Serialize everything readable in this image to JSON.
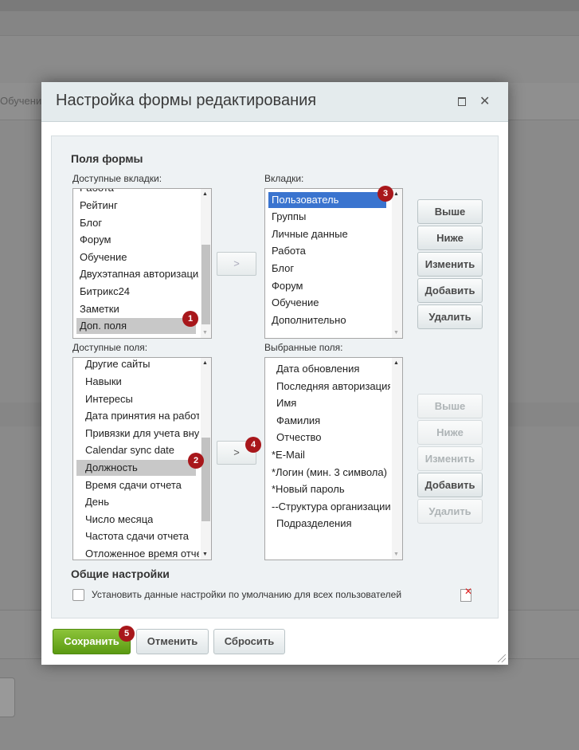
{
  "background": {
    "tab_fragment": "Обучение"
  },
  "dialog": {
    "title": "Настройка формы редактирования",
    "section_fields": "Поля формы",
    "available_tabs_label": "Доступные вкладки:",
    "tabs_label": "Вкладки:",
    "available_fields_label": "Доступные поля:",
    "selected_fields_label": "Выбранные поля:",
    "available_tabs": [
      "Работа",
      "Рейтинг",
      "Блог",
      "Форум",
      "Обучение",
      "Двухэтапная авторизация",
      "Битрикс24",
      "Заметки",
      "Доп. поля"
    ],
    "tabs": [
      "Пользователь",
      "Группы",
      "Личные данные",
      "Работа",
      "Блог",
      "Форум",
      "Обучение",
      "Дополнительно"
    ],
    "available_fields": [
      "Другие сайты",
      "Навыки",
      "Интересы",
      "Дата принятия на работу",
      "Привязки для учета внутренних",
      "Calendar sync date",
      "Должность",
      "Время сдачи отчета",
      "День",
      "Число месяца",
      "Частота сдачи отчета",
      "Отложенное время отчета"
    ],
    "selected_fields": [
      "Дата обновления",
      "Последняя авторизация",
      "Имя",
      "Фамилия",
      "Отчество",
      "*E-Mail",
      "*Логин (мин. 3 символа)",
      "*Новый пароль",
      "--Структура организации",
      "Подразделения"
    ],
    "move_tab_button": ">",
    "move_field_button": ">",
    "tab_buttons": {
      "up": "Выше",
      "down": "Ниже",
      "edit": "Изменить",
      "add": "Добавить",
      "delete": "Удалить"
    },
    "field_buttons": {
      "up": "Выше",
      "down": "Ниже",
      "edit": "Изменить",
      "add": "Добавить",
      "delete": "Удалить"
    },
    "section_general": "Общие настройки",
    "default_checkbox_label": "Установить данные настройки по умолчанию для всех пользователей",
    "footer": {
      "save": "Сохранить",
      "cancel": "Отменить",
      "reset": "Сбросить"
    },
    "badges": [
      "1",
      "2",
      "3",
      "4",
      "5"
    ]
  },
  "colors": {
    "selected": "#3a74cf",
    "highlight": "#c8c8c8",
    "badge": "#a8171b",
    "save": "#6aa81c"
  }
}
